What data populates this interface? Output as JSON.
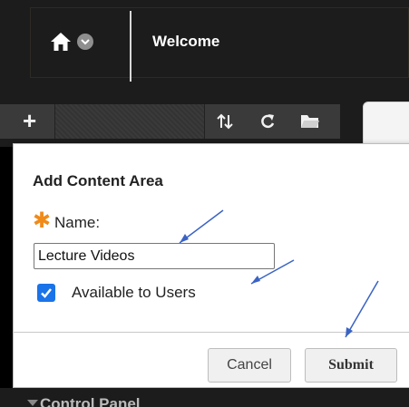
{
  "header": {
    "title": "Welcome",
    "icons": [
      "home-icon",
      "home-menu-icon"
    ]
  },
  "toolbar": {
    "icons": [
      "add-icon",
      "reorder-icon",
      "refresh-icon",
      "folder-icon"
    ],
    "add_glyph": "+"
  },
  "dialog": {
    "title": "Add Content Area",
    "name_label": "Name:",
    "name_value": "Lecture Videos",
    "available_label": "Available to Users",
    "available_checked": true,
    "cancel_label": "Cancel",
    "submit_label": "Submit"
  },
  "control_panel": {
    "label": "Control Panel"
  },
  "colors": {
    "required_star": "#f08a18",
    "checkbox": "#1a73e8",
    "annotation_arrow": "#3a63c4"
  }
}
